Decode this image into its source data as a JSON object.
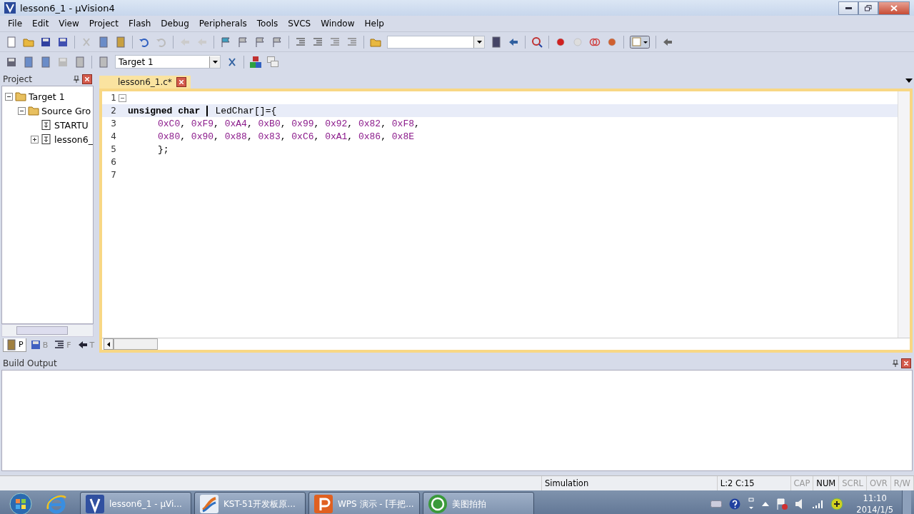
{
  "window": {
    "title": "lesson6_1  - µVision4"
  },
  "menu": [
    "File",
    "Edit",
    "View",
    "Project",
    "Flash",
    "Debug",
    "Peripherals",
    "Tools",
    "SVCS",
    "Window",
    "Help"
  ],
  "build_toolbar": {
    "target": "Target 1"
  },
  "project_panel": {
    "title": "Project",
    "tree": [
      {
        "label": "Target 1",
        "expanded": true,
        "children": [
          {
            "label": "Source Gro",
            "expanded": true,
            "children": [
              {
                "label": "STARTU"
              },
              {
                "label": "lesson6_",
                "expanded": false
              }
            ]
          }
        ]
      }
    ],
    "tabs": [
      {
        "label": "P",
        "selected": true
      },
      {
        "label": "B",
        "selected": false
      },
      {
        "label": "F",
        "selected": false
      },
      {
        "label": "T",
        "selected": false
      }
    ]
  },
  "editor": {
    "tabs": [
      {
        "label": "lesson6_1.c*",
        "selected": true
      }
    ],
    "lines": [
      {
        "number": "1",
        "current": false
      },
      {
        "number": "2",
        "current": true,
        "indent": false,
        "tokens": [
          {
            "kind": "keyword",
            "text": "unsigned char"
          },
          {
            "kind": "cursor"
          },
          {
            "kind": "plain",
            "text": "LedChar[]={"
          }
        ]
      },
      {
        "number": "3",
        "current": false,
        "indent": true,
        "tokens": [
          {
            "kind": "number",
            "text": "0xC0"
          },
          {
            "kind": "punct",
            "text": ","
          },
          {
            "kind": "number",
            "text": "0xF9"
          },
          {
            "kind": "punct",
            "text": ","
          },
          {
            "kind": "number",
            "text": "0xA4"
          },
          {
            "kind": "punct",
            "text": ","
          },
          {
            "kind": "number",
            "text": "0xB0"
          },
          {
            "kind": "punct",
            "text": ","
          },
          {
            "kind": "number",
            "text": "0x99"
          },
          {
            "kind": "punct",
            "text": ","
          },
          {
            "kind": "number",
            "text": "0x92"
          },
          {
            "kind": "punct",
            "text": ","
          },
          {
            "kind": "number",
            "text": "0x82"
          },
          {
            "kind": "punct",
            "text": ","
          },
          {
            "kind": "number",
            "text": "0xF8"
          },
          {
            "kind": "punct",
            "text": ","
          }
        ]
      },
      {
        "number": "4",
        "current": false,
        "indent": true,
        "tokens": [
          {
            "kind": "number",
            "text": "0x80"
          },
          {
            "kind": "punct",
            "text": ","
          },
          {
            "kind": "number",
            "text": "0x90"
          },
          {
            "kind": "punct",
            "text": ","
          },
          {
            "kind": "number",
            "text": "0x88"
          },
          {
            "kind": "punct",
            "text": ","
          },
          {
            "kind": "number",
            "text": "0x83"
          },
          {
            "kind": "punct",
            "text": ","
          },
          {
            "kind": "number",
            "text": "0xC6"
          },
          {
            "kind": "punct",
            "text": ","
          },
          {
            "kind": "number",
            "text": "0xA1"
          },
          {
            "kind": "punct",
            "text": ","
          },
          {
            "kind": "number",
            "text": "0x86"
          },
          {
            "kind": "punct",
            "text": ","
          },
          {
            "kind": "number",
            "text": "0x8E"
          }
        ]
      },
      {
        "number": "5",
        "current": false,
        "indent": true,
        "tokens": [
          {
            "kind": "plain",
            "text": "};"
          }
        ]
      },
      {
        "number": "6",
        "current": false
      },
      {
        "number": "7",
        "current": false
      }
    ]
  },
  "build_output": {
    "title": "Build Output"
  },
  "status_bar": {
    "mode": "Simulation",
    "position": "L:2 C:15",
    "indicators": [
      {
        "label": "CAP",
        "on": false
      },
      {
        "label": "NUM",
        "on": true
      },
      {
        "label": "SCRL",
        "on": false
      },
      {
        "label": "OVR",
        "on": false
      },
      {
        "label": "R/W",
        "on": false
      }
    ]
  },
  "taskbar": {
    "items": [
      {
        "kind": "uvision",
        "label": "lesson6_1  - µVi..."
      },
      {
        "kind": "chart",
        "label": "KST-51开发板原..."
      },
      {
        "kind": "presentation",
        "label": "WPS 演示 - [手把..."
      },
      {
        "kind": "photo",
        "label": "美图拍拍"
      }
    ],
    "time": "11:10",
    "date": "2014/1/5"
  }
}
